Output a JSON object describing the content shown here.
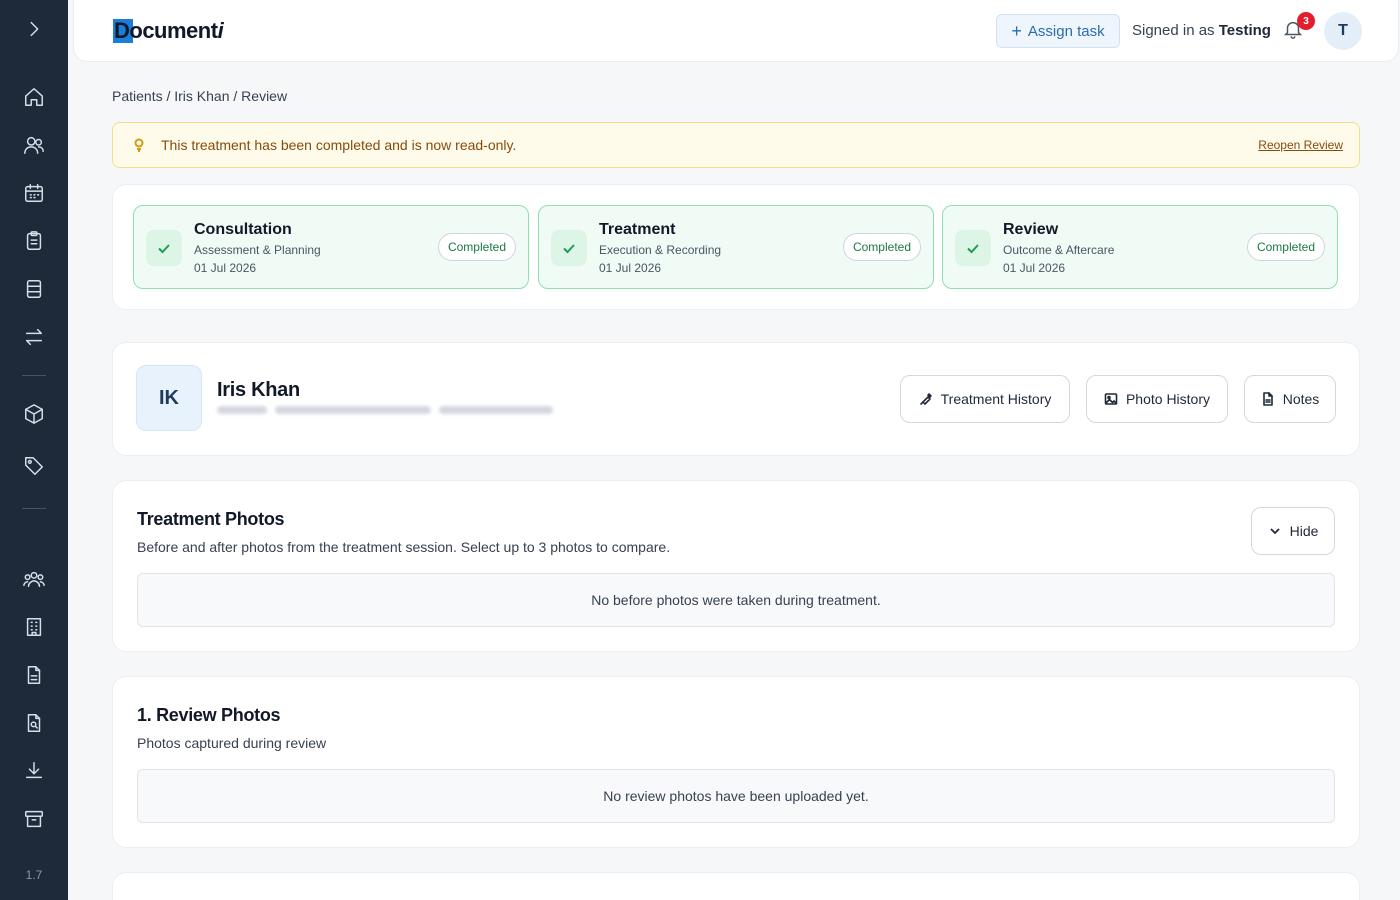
{
  "app": {
    "logo_text_main": "Document",
    "logo_text_accent": "i",
    "version": "1.7"
  },
  "sidebar": {
    "icons": [
      "chevron-right-icon",
      "home-icon",
      "users-icon",
      "calendar-icon",
      "clipboard-icon",
      "binder-icon",
      "transfer-icon",
      "cube-icon",
      "tag-icon",
      "team-icon",
      "building-icon",
      "file-text-icon",
      "file-search-icon",
      "download-icon",
      "archive-icon"
    ]
  },
  "header": {
    "assign_task": "Assign task",
    "signed_in_prefix": "Signed in as",
    "signed_in_user": "Testing",
    "notification_count": "3",
    "avatar_initial": "T"
  },
  "breadcrumb": "Patients / Iris Khan / Review",
  "alert": {
    "message": "This treatment has been completed and is now read-only.",
    "action": "Reopen Review"
  },
  "stages": [
    {
      "title": "Consultation",
      "subtitle": "Assessment & Planning",
      "date": "01 Jul 2026",
      "status": "Completed"
    },
    {
      "title": "Treatment",
      "subtitle": "Execution & Recording",
      "date": "01 Jul 2026",
      "status": "Completed"
    },
    {
      "title": "Review",
      "subtitle": "Outcome & Aftercare",
      "date": "01 Jul 2026",
      "status": "Completed"
    }
  ],
  "patient": {
    "initials": "IK",
    "name": "Iris Khan",
    "buttons": {
      "treatment_history": "Treatment History",
      "photo_history": "Photo History",
      "notes": "Notes"
    }
  },
  "treatment_photos": {
    "title": "Treatment Photos",
    "subtitle": "Before and after photos from the treatment session. Select up to 3 photos to compare.",
    "hide_label": "Hide",
    "empty": "No before photos were taken during treatment."
  },
  "review_photos": {
    "title": "1. Review Photos",
    "subtitle": "Photos captured during review",
    "empty": "No review photos have been uploaded yet."
  },
  "colors": {
    "sidebar_bg": "#1e2a3a",
    "accent": "#1b7ed8",
    "success": "#1f9d55",
    "warning_bg": "#fefbea",
    "badge": "#e11d2e"
  }
}
